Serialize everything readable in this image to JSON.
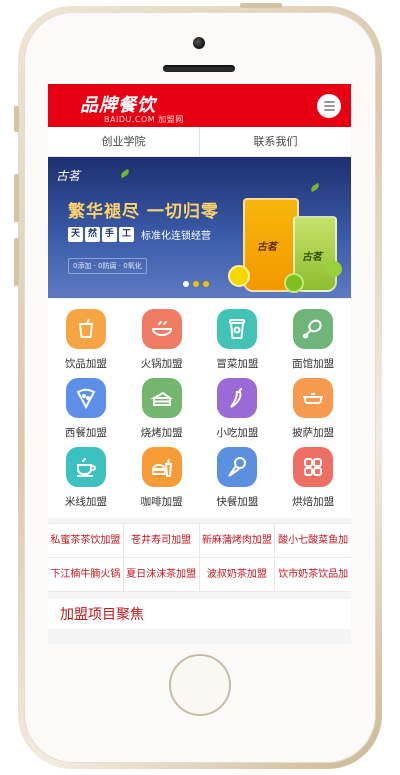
{
  "header": {
    "logo_main": "品牌餐饮",
    "logo_sub": "BAIDU.COM 加盟网"
  },
  "nav": [
    {
      "label": "创业学院"
    },
    {
      "label": "联系我们"
    }
  ],
  "banner": {
    "brand": "古茗",
    "headline": "繁华褪尽 一切归零",
    "tags": [
      "天",
      "然",
      "手",
      "工"
    ],
    "tagline": "标准化连锁经营",
    "badges": "0添加 · 0防腐 · 0氧化",
    "cup_brand": "古茗",
    "active_slide": 2,
    "slide_count": 3
  },
  "categories": [
    {
      "label": "饮品加盟",
      "icon": "drink-cup-icon",
      "color": "#f7a543"
    },
    {
      "label": "火锅加盟",
      "icon": "hotpot-icon",
      "color": "#ef7b63"
    },
    {
      "label": "冒菜加盟",
      "icon": "takeaway-cup-icon",
      "color": "#42c3b6"
    },
    {
      "label": "面馆加盟",
      "icon": "drumstick-icon",
      "color": "#6fb57a"
    },
    {
      "label": "西餐加盟",
      "icon": "pizza-icon",
      "color": "#5d8fe8"
    },
    {
      "label": "烧烤加盟",
      "icon": "cake-icon",
      "color": "#73b76e"
    },
    {
      "label": "小吃加盟",
      "icon": "chili-icon",
      "color": "#9a6ad6"
    },
    {
      "label": "披萨加盟",
      "icon": "pan-icon",
      "color": "#f59a4e"
    },
    {
      "label": "米线加盟",
      "icon": "teacup-icon",
      "color": "#3dc0c0"
    },
    {
      "label": "咖啡加盟",
      "icon": "burger-drink-icon",
      "color": "#f79b36"
    },
    {
      "label": "快餐加盟",
      "icon": "ice-cream-icon",
      "color": "#5c8fe0"
    },
    {
      "label": "烘焙加盟",
      "icon": "grid-icon",
      "color": "#ef6e64"
    }
  ],
  "links": [
    "私蜜茶茶饮加盟",
    "苍井寿司加盟",
    "新麻蒲烤肉加盟",
    "酸小七酸菜鱼加",
    "下江楠牛腩火锅",
    "夏日沫沫茶加盟",
    "波叔奶茶加盟",
    "饮市奶茶饮品加"
  ],
  "section_title": "加盟项目聚焦"
}
